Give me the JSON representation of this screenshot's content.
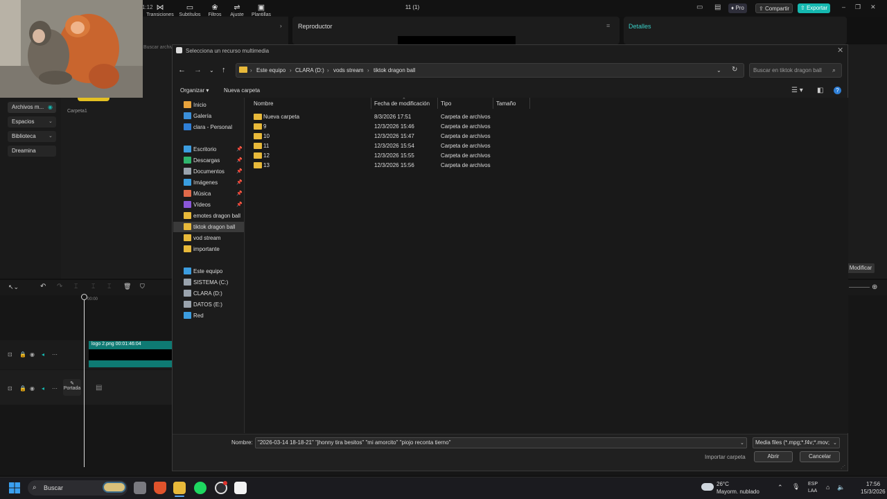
{
  "editor": {
    "time_fragment": "1:12",
    "project_title": "11 (1)",
    "pro_label": "Pro",
    "share_label": "Compartir",
    "export_label": "Exportar",
    "tools": [
      {
        "label": "Transiciones",
        "icon": "transitions-icon"
      },
      {
        "label": "Subtítulos",
        "icon": "subtitles-icon"
      },
      {
        "label": "Filtros",
        "icon": "filters-icon"
      },
      {
        "label": "Ajuste",
        "icon": "adjust-icon"
      },
      {
        "label": "Plantillas",
        "icon": "templates-icon"
      }
    ],
    "player_title": "Reproductor",
    "details_title": "Detalles",
    "search_hint": "Buscar archiv",
    "left_menu": [
      "Archivos m...",
      "Espacios",
      "Biblioteca",
      "Dreamina"
    ],
    "folder_caption": "Carpeta1",
    "modify_label": "Modificar",
    "timeline_time": "00:00",
    "clip_label": "logo 2.png  00:01:46:04",
    "cover_label": "Portada"
  },
  "dialog": {
    "title": "Selecciona un recurso multimedia",
    "breadcrumb": [
      "Este equipo",
      "CLARA (D:)",
      "vods stream",
      "tiktok dragon ball"
    ],
    "search_placeholder": "Buscar en tiktok dragon ball",
    "organize_label": "Organizar",
    "new_folder_label": "Nueva carpeta",
    "nav_items": [
      {
        "label": "Inicio",
        "icon": "home-icon",
        "color": "#e8a33c"
      },
      {
        "label": "Galería",
        "icon": "gallery-icon",
        "color": "#3b8fd9"
      },
      {
        "label": "clara - Personal",
        "icon": "onedrive-icon",
        "color": "#2f7fd6"
      },
      {
        "label": "Escritorio",
        "icon": "desktop-icon",
        "color": "#3c9de0",
        "pinned": true
      },
      {
        "label": "Descargas",
        "icon": "downloads-icon",
        "color": "#2fb56d",
        "pinned": true
      },
      {
        "label": "Documentos",
        "icon": "documents-icon",
        "color": "#9aa3ad",
        "pinned": true
      },
      {
        "label": "Imágenes",
        "icon": "pictures-icon",
        "color": "#3a9ee0",
        "pinned": true
      },
      {
        "label": "Música",
        "icon": "music-icon",
        "color": "#e06a4a",
        "pinned": true
      },
      {
        "label": "Vídeos",
        "icon": "videos-icon",
        "color": "#8a57d8",
        "pinned": true
      },
      {
        "label": "emotes dragon ball",
        "icon": "folder-icon",
        "color": "#e8b93a"
      },
      {
        "label": "tiktok dragon ball",
        "icon": "folder-icon",
        "color": "#e8b93a",
        "selected": true
      },
      {
        "label": "vod stream",
        "icon": "folder-icon",
        "color": "#e8b93a"
      },
      {
        "label": "importante",
        "icon": "folder-icon",
        "color": "#e8b93a"
      },
      {
        "label": "Este equipo",
        "icon": "computer-icon",
        "color": "#3c9de0"
      },
      {
        "label": "SISTEMA (C:)",
        "icon": "drive-icon",
        "color": "#9aa3ad"
      },
      {
        "label": "CLARA (D:)",
        "icon": "drive-icon",
        "color": "#9aa3ad"
      },
      {
        "label": "DATOS (E:)",
        "icon": "drive-icon",
        "color": "#9aa3ad"
      },
      {
        "label": "Red",
        "icon": "network-icon",
        "color": "#3c9de0"
      }
    ],
    "columns": [
      "Nombre",
      "Fecha de modificación",
      "Tipo",
      "Tamaño"
    ],
    "rows": [
      {
        "name": "Nueva carpeta",
        "date": "8/3/2026 17:51",
        "type": "Carpeta de archivos"
      },
      {
        "name": "9",
        "date": "12/3/2026 15:46",
        "type": "Carpeta de archivos"
      },
      {
        "name": "10",
        "date": "12/3/2026 15:47",
        "type": "Carpeta de archivos"
      },
      {
        "name": "11",
        "date": "12/3/2026 15:54",
        "type": "Carpeta de archivos"
      },
      {
        "name": "12",
        "date": "12/3/2026 15:55",
        "type": "Carpeta de archivos"
      },
      {
        "name": "13",
        "date": "12/3/2026 15:56",
        "type": "Carpeta de archivos"
      }
    ],
    "filename_label": "Nombre:",
    "filename_value": "\"2026-03-14 18-18-21\" \"jhonny tira besitos\" \"mi amorcito\" \"piojo reconta tierno\"",
    "filter_value": "Media files (*.mpg;*.f4v;*.mov;",
    "import_folder_label": "Importar carpeta",
    "open_label": "Abrir",
    "cancel_label": "Cancelar"
  },
  "taskbar": {
    "search_label": "Buscar",
    "weather_temp": "26°C",
    "weather_desc": "Mayorm. nublado",
    "lang_top": "ESP",
    "lang_bottom": "LAA",
    "time": "17:56",
    "date": "15/3/2026"
  },
  "colors": {
    "accent_teal": "#15b8b0",
    "folder_yellow": "#e8b93a",
    "windows_blue": "#2f7fd6"
  }
}
